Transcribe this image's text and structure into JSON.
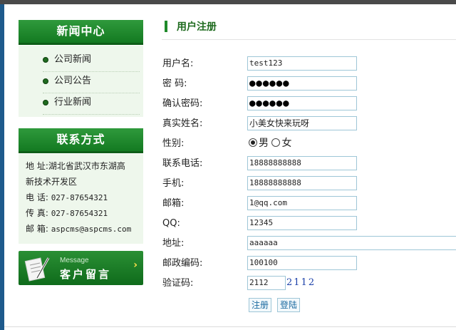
{
  "sidebar": {
    "news_title": "新闻中心",
    "news_items": [
      "公司新闻",
      "公司公告",
      "行业新闻"
    ],
    "contact_title": "联系方式",
    "contact": {
      "address_label": "地 址:",
      "address_line1": "湖北省武汉市东湖高",
      "address_line2": "新技术开发区",
      "phone_label": "电 话:",
      "phone": "027-87654321",
      "fax_label": "传 真:",
      "fax": "027-87654321",
      "email_label": "邮 箱:",
      "email": "aspcms@aspcms.com"
    },
    "message_button": {
      "en": "Message",
      "cn": "客户留言"
    }
  },
  "form": {
    "title": "用户注册",
    "username_label": "用户名:",
    "username": "test123",
    "password_label": "密  码:",
    "password_mask": "●●●●●●",
    "confirm_label": "确认密码:",
    "confirm_mask": "●●●●●●",
    "realname_label": "真实姓名:",
    "realname": "小美女快来玩呀",
    "gender_label": "性别:",
    "gender_male": "男",
    "gender_female": "女",
    "gender_selected": "男",
    "phone_label": "联系电话:",
    "phone": "18888888888",
    "mobile_label": "手机:",
    "mobile": "18888888888",
    "email_label": "邮箱:",
    "email": "1@qq.com",
    "qq_label": "QQ:",
    "qq": "12345",
    "address_label": "地址:",
    "address": "aaaaaa",
    "zip_label": "邮政编码:",
    "zip": "100100",
    "captcha_label": "验证码:",
    "captcha_input": "2112",
    "captcha_image_text": "2112",
    "register_button": "注册",
    "login_button": "登陆"
  },
  "colors": {
    "brand_green": "#137a21",
    "field_border": "#9ec6d7",
    "link_blue": "#1b6aa0"
  }
}
